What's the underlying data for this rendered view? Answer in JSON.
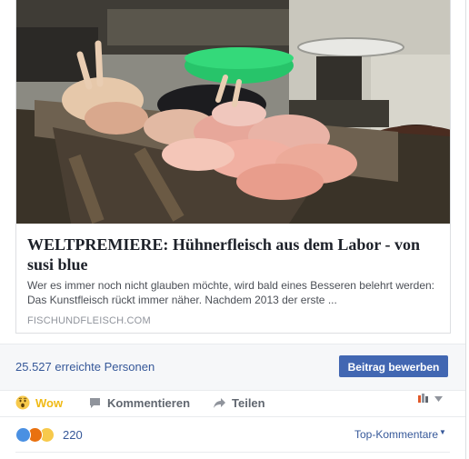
{
  "link_preview": {
    "title": "WELTPREMIERE: Hühnerfleisch aus dem Labor - von susi blue",
    "description": "Wer es immer noch nicht glauben möchte, wird bald eines Besseren belehrt werden: Das Kunstfleisch rückt immer näher. Nachdem 2013 der erste ...",
    "domain": "FISCHUNDFLEISCH.COM"
  },
  "stats": {
    "reach_text": "25.527 erreichte Personen",
    "boost_label": "Beitrag bewerben"
  },
  "actions": {
    "wow_label": "Wow",
    "comment_label": "Kommentieren",
    "share_label": "Teilen"
  },
  "reactions": {
    "count": "220",
    "sort_label": "Top-Kommentare"
  },
  "colors": {
    "link_blue": "#365899",
    "button_blue": "#4267b2",
    "wow_yellow": "#f0ba15",
    "like_blue": "#4a90e2",
    "angry_red": "#e9710f"
  }
}
